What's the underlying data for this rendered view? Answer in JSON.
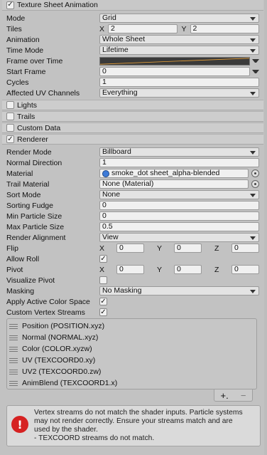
{
  "texture_sheet": {
    "header": "Texture Sheet Animation",
    "header_checked": "✓",
    "mode": {
      "label": "Mode",
      "value": "Grid"
    },
    "tiles": {
      "label": "Tiles",
      "x_axis": "X",
      "x": "2",
      "y_axis": "Y",
      "y": "2"
    },
    "animation": {
      "label": "Animation",
      "value": "Whole Sheet"
    },
    "time_mode": {
      "label": "Time Mode",
      "value": "Lifetime"
    },
    "frame_over_time": {
      "label": "Frame over Time"
    },
    "start_frame": {
      "label": "Start Frame",
      "value": "0"
    },
    "cycles": {
      "label": "Cycles",
      "value": "1"
    },
    "uv_channels": {
      "label": "Affected UV Channels",
      "value": "Everything"
    }
  },
  "modules": {
    "lights": "Lights",
    "trails": "Trails",
    "custom_data": "Custom Data",
    "renderer": "Renderer",
    "renderer_checked": "✓"
  },
  "renderer": {
    "render_mode": {
      "label": "Render Mode",
      "value": "Billboard"
    },
    "normal_direction": {
      "label": "Normal Direction",
      "value": "1"
    },
    "material": {
      "label": "Material",
      "value": "smoke_dot sheet_alpha-blended"
    },
    "trail_material": {
      "label": "Trail Material",
      "value": "None (Material)"
    },
    "sort_mode": {
      "label": "Sort Mode",
      "value": "None"
    },
    "sorting_fudge": {
      "label": "Sorting Fudge",
      "value": "0"
    },
    "min_particle_size": {
      "label": "Min Particle Size",
      "value": "0"
    },
    "max_particle_size": {
      "label": "Max Particle Size",
      "value": "0.5"
    },
    "render_alignment": {
      "label": "Render Alignment",
      "value": "View"
    },
    "flip": {
      "label": "Flip",
      "x_axis": "X",
      "x": "0",
      "y_axis": "Y",
      "y": "0",
      "z_axis": "Z",
      "z": "0"
    },
    "allow_roll": {
      "label": "Allow Roll",
      "checked": "✓"
    },
    "pivot": {
      "label": "Pivot",
      "x_axis": "X",
      "x": "0",
      "y_axis": "Y",
      "y": "0",
      "z_axis": "Z",
      "z": "0"
    },
    "visualize_pivot": {
      "label": "Visualize Pivot",
      "checked": ""
    },
    "masking": {
      "label": "Masking",
      "value": "No Masking"
    },
    "apply_active_color_space": {
      "label": "Apply Active Color Space",
      "checked": "✓"
    },
    "custom_vertex_streams": {
      "label": "Custom Vertex Streams",
      "checked": "✓"
    }
  },
  "streams": [
    "Position (POSITION.xyz)",
    "Normal (NORMAL.xyz)",
    "Color (COLOR.xyzw)",
    "UV (TEXCOORD0.xy)",
    "UV2 (TEXCOORD0.zw)",
    "AnimBlend (TEXCOORD1.x)"
  ],
  "list_controls": {
    "add": "+.",
    "remove": "−"
  },
  "warning": {
    "icon": "!",
    "line1": "Vertex streams do not match the shader inputs. Particle systems",
    "line2": "may not render correctly. Ensure your streams match and are",
    "line3": "used by the shader.",
    "line4": "- TEXCOORD streams do not match."
  },
  "colors": {
    "error": "#d62222",
    "curve_line": "#e8a13a",
    "material_icon": "#3e7bd8"
  }
}
